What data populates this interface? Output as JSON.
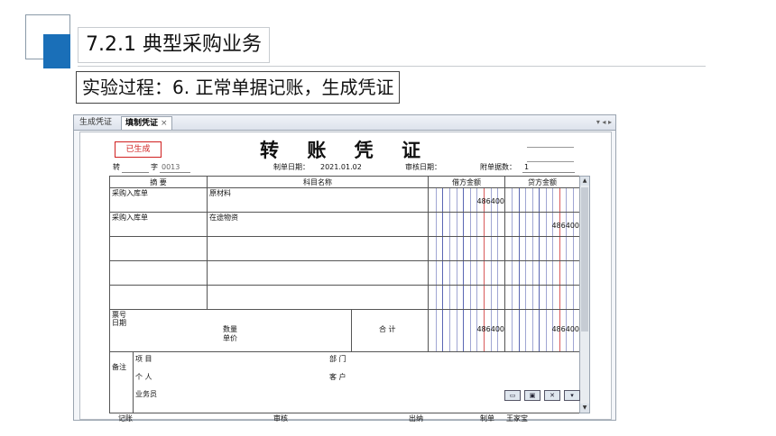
{
  "slide": {
    "title": "7.2.1  典型采购业务",
    "subtitle": "实验过程：6. 正常单据记账，生成凭证",
    "accent_color": "#1a6fb8"
  },
  "window": {
    "tabs": [
      {
        "label": "生成凭证"
      },
      {
        "label": "填制凭证"
      }
    ],
    "tab_close_glyph": "×",
    "controls_glyph": "▾ ◂ ▸"
  },
  "voucher": {
    "title": "转 账 凭 证",
    "status_stamp": "已生成",
    "type_label": "转",
    "number_label": "字",
    "number": "0013",
    "date_label": "制单日期：",
    "date": "2021.01.02",
    "audit_date_label": "审核日期：",
    "attachments_label": "附单据数：",
    "attachments": "1",
    "headers": {
      "summary": "摘 要",
      "account": "科目名称",
      "debit": "借方金额",
      "credit": "贷方金额"
    },
    "rows": [
      {
        "summary": "采购入库单",
        "account": "原材料",
        "debit": "486400",
        "credit": ""
      },
      {
        "summary": "采购入库单",
        "account": "在途物资",
        "debit": "",
        "credit": "486400"
      },
      {
        "summary": "",
        "account": "",
        "debit": "",
        "credit": ""
      },
      {
        "summary": "",
        "account": "",
        "debit": "",
        "credit": ""
      },
      {
        "summary": "",
        "account": "",
        "debit": "",
        "credit": ""
      }
    ],
    "footer": {
      "ticket_no_label": "票号",
      "date_label": "日期",
      "quantity_label": "数量",
      "unit_price_label": "单价",
      "total_label": "合 计",
      "total_debit": "486400",
      "total_credit": "486400"
    },
    "remarks": {
      "label": "备注",
      "project_label": "项 目",
      "department_label": "部 门",
      "person_label": "个 人",
      "customer_label": "客 户",
      "salesperson_label": "业务员"
    },
    "signatures": {
      "bookkeeper_label": "记账",
      "reviewer_label": "审核",
      "cashier_label": "出纳",
      "maker_label": "制单",
      "maker_name": "王家宝"
    }
  }
}
